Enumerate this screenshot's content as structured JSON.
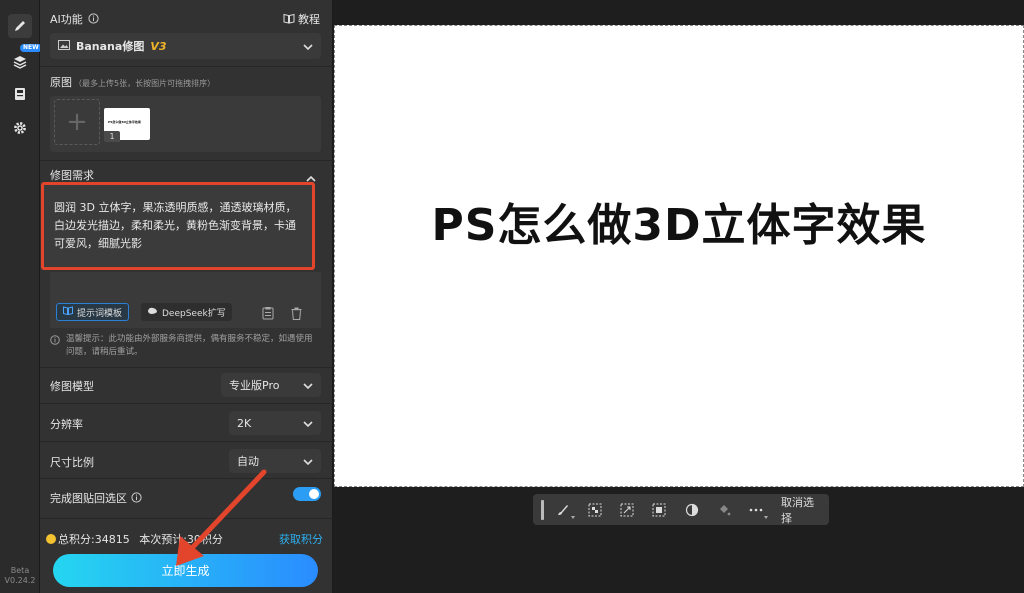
{
  "rail": {
    "new_badge": "NEW",
    "beta_label": "Beta",
    "version": "V0.24.2",
    "icons": [
      "brush-icon",
      "layers-icon",
      "save-icon",
      "gear-icon"
    ]
  },
  "panel": {
    "section_title": "AI功能",
    "tutorial_label": "教程",
    "function_select": {
      "label": "Banana修图",
      "badge": "V3"
    },
    "original": {
      "title": "原图",
      "hint": "（最多上传5张，长按图片可拖拽排序）",
      "thumb_index": "1",
      "thumb_text": "PS怎么做3D立体字效果"
    },
    "requirement": {
      "title": "修图需求",
      "text": "圆润 3D 立体字，果冻透明质感，通透玻璃材质，白边发光描边，柔和柔光，黄粉色渐变背景，卡通可爱风，细腻光影",
      "template_button": "提示词模板",
      "deepseek_button": "DeepSeek扩写"
    },
    "notice": "温馨提示：此功能由外部服务商提供，偶有服务不稳定，如遇使用问题，请稍后重试。",
    "model": {
      "label": "修图模型",
      "value": "专业版Pro"
    },
    "resolution": {
      "label": "分辨率",
      "value": "2K"
    },
    "ratio": {
      "label": "尺寸比例",
      "value": "自动"
    },
    "paste_back": {
      "label": "完成图贴回选区",
      "enabled": true
    },
    "points": {
      "total": "总积分:34815",
      "estimate": "本次预计:30积分"
    },
    "earn_points": "获取积分",
    "generate_button": "立即生成"
  },
  "canvas": {
    "title": "PS怎么做3D立体字效果"
  },
  "toolbar": {
    "cancel_selection": "取消选择"
  },
  "colors": {
    "highlight_border": "#e2452c",
    "accent": "#2b9df4",
    "badge_gold": "#f0b429"
  }
}
